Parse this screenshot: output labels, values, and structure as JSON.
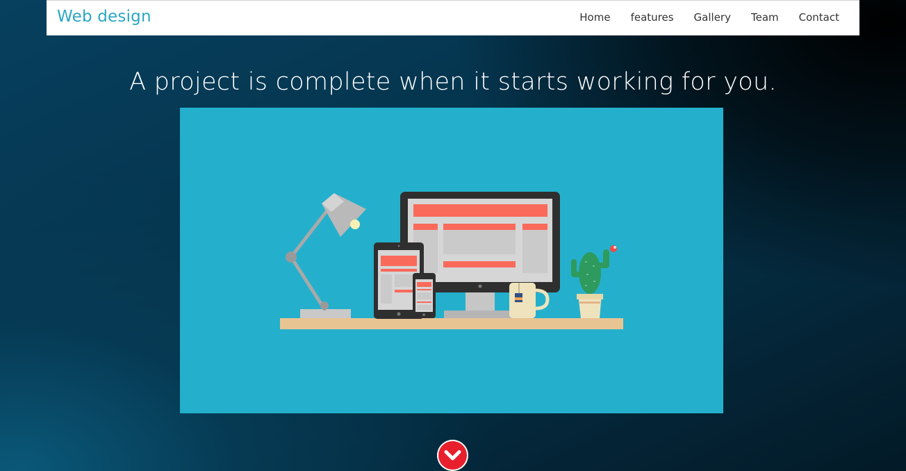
{
  "navbar": {
    "brand": "Web design",
    "links": [
      "Home",
      "features",
      "Gallery",
      "Team",
      "Contact"
    ]
  },
  "hero": {
    "headline": "A project is complete when it starts working for you.",
    "illustration_icon": "workspace-desk-illustration"
  },
  "scroll_button": {
    "icon": "chevron-down-icon"
  },
  "colors": {
    "brand": "#2aa6c4",
    "hero_bg": "#24b0cc",
    "accent_red": "#e8202d",
    "screen_red": "#f96a5b"
  }
}
